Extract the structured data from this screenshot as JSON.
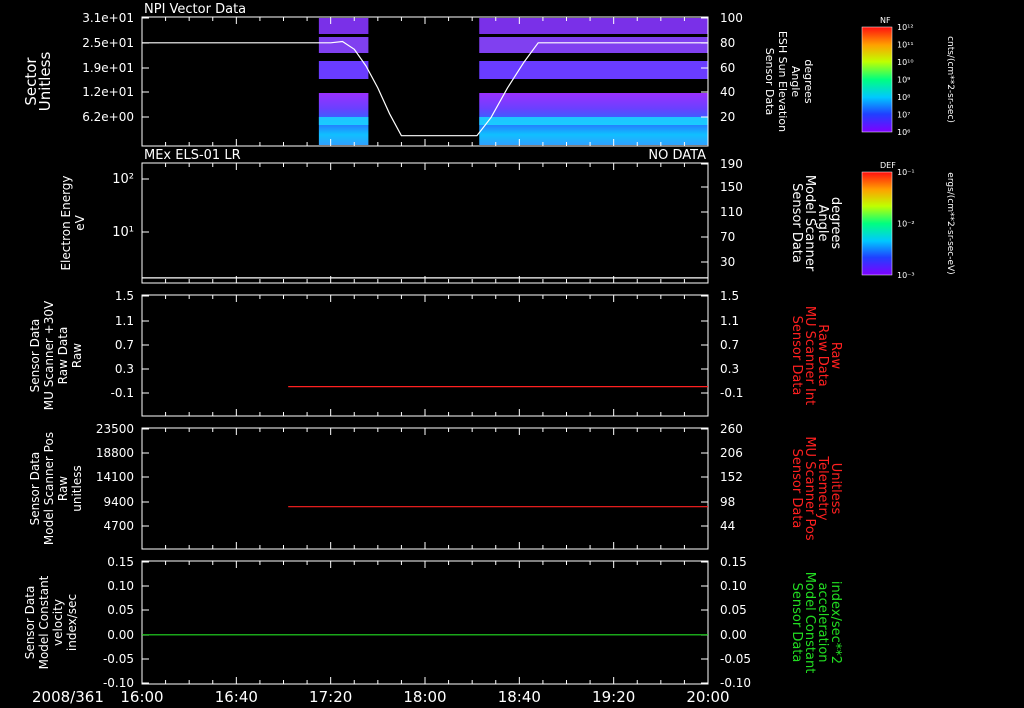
{
  "chart_data": {
    "type": "line",
    "date_label": "2008/361",
    "time_ticks": [
      "16:00",
      "16:40",
      "17:20",
      "18:00",
      "18:40",
      "19:20",
      "20:00"
    ],
    "panels": [
      {
        "id": "npi",
        "kind": "spectrogram",
        "title": "NPI Vector Data",
        "status": "",
        "ylabel_left": [
          "Sector",
          "Unitless"
        ],
        "ylabel_left_color": "#ffffff",
        "left_ticks": [
          "3.1e+01",
          "2.5e+01",
          "1.9e+01",
          "1.2e+01",
          "6.2e+00"
        ],
        "ylabel_right": [
          "Sensor Data",
          "ESH Sun Elevation",
          "Angle",
          "degrees"
        ],
        "ylabel_right_color": "#ffffff",
        "right_ticks": [
          "100",
          "80",
          "60",
          "40",
          "20"
        ],
        "right_ylim": [
          0,
          100
        ],
        "line_color": "#ffffff",
        "line_series": {
          "x": [
            "16:00",
            "17:20",
            "17:25",
            "17:30",
            "17:35",
            "17:40",
            "17:45",
            "17:50",
            "18:22",
            "18:28",
            "18:35",
            "18:42",
            "18:48",
            "20:00"
          ],
          "y": [
            80,
            80,
            81,
            75,
            62,
            45,
            25,
            8,
            8,
            22,
            45,
            65,
            80,
            80
          ]
        },
        "data_blocks": [
          {
            "start": "17:15",
            "end": "17:36"
          },
          {
            "start": "18:23",
            "end": "20:00"
          }
        ],
        "colorbar": {
          "label": "NF",
          "unit": "cnts/(cm**2-sr-sec)",
          "ticks": [
            "10¹²",
            "10¹¹",
            "10¹⁰",
            "10⁹",
            "10⁸",
            "10⁷",
            "10⁶"
          ]
        }
      },
      {
        "id": "els",
        "kind": "line",
        "title": "MEx ELS-01 LR",
        "status": "NO DATA",
        "ylabel_left": [
          "Electron Energy",
          "eV"
        ],
        "ylabel_left_color": "#ffffff",
        "left_ticks": [
          "10²",
          "10¹"
        ],
        "ylabel_right": [
          "Sensor Data",
          "Model Scanner",
          "Angle",
          "degrees"
        ],
        "ylabel_right_color": "#ffffff",
        "right_ticks": [
          "190",
          "150",
          "110",
          "70",
          "30"
        ],
        "right_ylim": [
          0,
          190
        ],
        "line_color": "#ffffff",
        "line_series": {
          "x": [
            "16:00",
            "20:00"
          ],
          "y": [
            8,
            8
          ]
        },
        "colorbar": {
          "label": "DEF",
          "unit": "ergs/(cm**2-sr-sec-eV)",
          "ticks": [
            "10⁻¹",
            "10⁻²",
            "10⁻³"
          ]
        }
      },
      {
        "id": "mu-int",
        "kind": "line",
        "title": "",
        "status": "",
        "ylabel_left": [
          "Sensor Data",
          "MU Scanner +30V",
          "Raw Data",
          "Raw"
        ],
        "ylabel_left_color": "#ffffff",
        "left_ticks": [
          "1.5",
          "1.1",
          "0.7",
          "0.3",
          "-0.1"
        ],
        "ylabel_right": [
          "Sensor Data",
          "MU Scanner Int",
          "Raw Data",
          "Raw"
        ],
        "ylabel_right_color": "#ff2020",
        "right_ticks": [
          "1.5",
          "1.1",
          "0.7",
          "0.3",
          "-0.1"
        ],
        "right_ylim": [
          -0.35,
          1.5
        ],
        "line_color": "#ff2020",
        "line_series": {
          "x": [
            "17:02",
            "20:00"
          ],
          "y": [
            0.1,
            0.1
          ]
        }
      },
      {
        "id": "mu-pos",
        "kind": "line",
        "title": "",
        "status": "",
        "ylabel_left": [
          "Sensor Data",
          "Model Scanner Pos",
          "Raw",
          "unitless"
        ],
        "ylabel_left_color": "#ffffff",
        "left_ticks": [
          "23500",
          "18800",
          "14100",
          "9400",
          "4700"
        ],
        "ylabel_right": [
          "Sensor Data",
          "MU Scanner Pos",
          "Telemetry",
          "Unitless"
        ],
        "ylabel_right_color": "#ff2020",
        "right_ticks": [
          "260",
          "206",
          "152",
          "98",
          "44"
        ],
        "right_ylim": [
          -9,
          260
        ],
        "line_color": "#ff2020",
        "line_series": {
          "x": [
            "17:02",
            "20:00"
          ],
          "y": [
            85,
            85
          ]
        }
      },
      {
        "id": "model-const",
        "kind": "line",
        "title": "",
        "status": "",
        "ylabel_left": [
          "Sensor Data",
          "Model Constant",
          "velocity",
          "index/sec"
        ],
        "ylabel_left_color": "#ffffff",
        "left_ticks": [
          "0.15",
          "0.10",
          "0.05",
          "0.00",
          "-0.05",
          "-0.10"
        ],
        "ylabel_right": [
          "Sensor Data",
          "Model Constant",
          "acceleration",
          "index/sec**2"
        ],
        "ylabel_right_color": "#22dd22",
        "right_ticks": [
          "0.15",
          "0.10",
          "0.05",
          "0.00",
          "-0.05",
          "-0.10"
        ],
        "right_ylim": [
          -0.1,
          0.15
        ],
        "line_color": "#22dd22",
        "line_series": {
          "x": [
            "16:00",
            "20:00"
          ],
          "y": [
            0.0,
            0.0
          ]
        }
      }
    ]
  }
}
